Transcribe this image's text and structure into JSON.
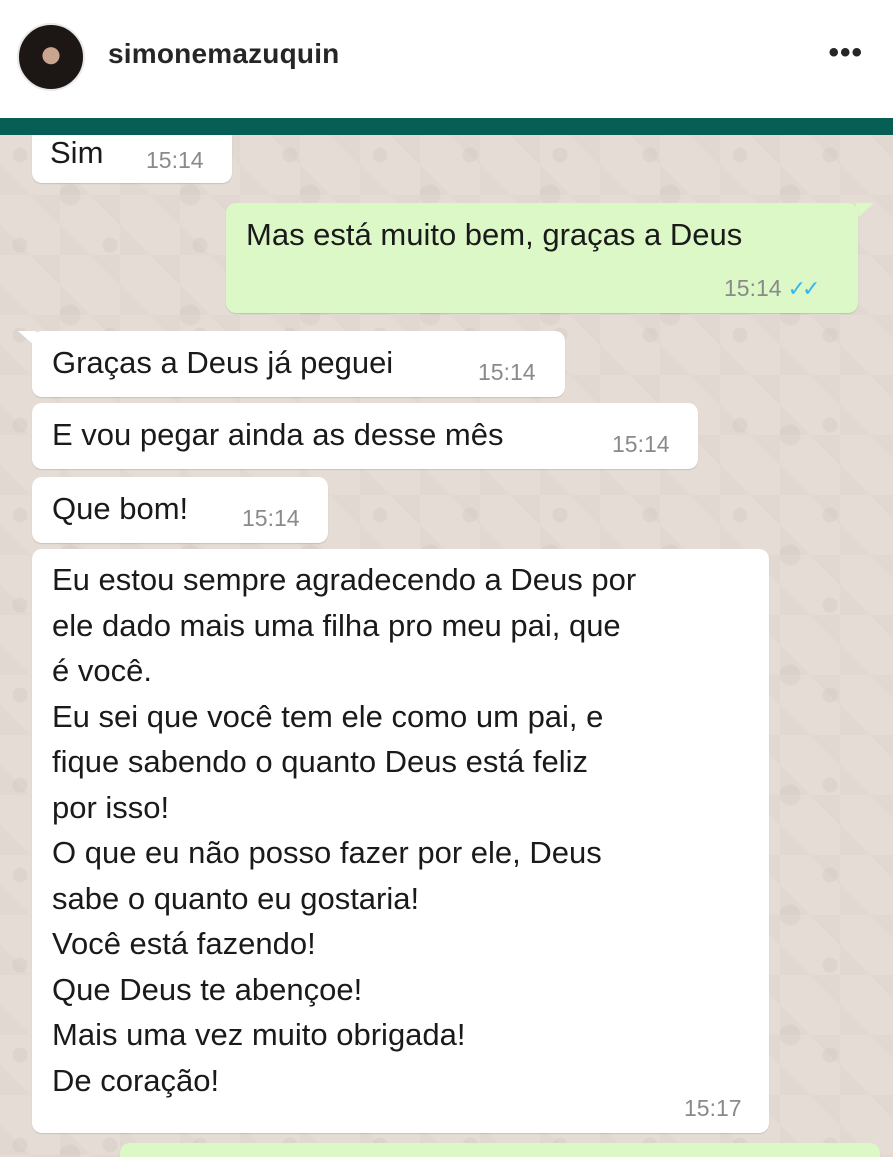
{
  "post_header": {
    "username": "simonemazuquin",
    "more_icon": "•••"
  },
  "chat": {
    "messages": [
      {
        "direction": "in",
        "text": "Sim",
        "time": "15:14"
      },
      {
        "direction": "out",
        "text": "Mas está muito bem, graças a Deus",
        "time": "15:14",
        "status_icon": "double-check-read"
      },
      {
        "direction": "in",
        "text": "Graças a Deus já peguei",
        "time": "15:14"
      },
      {
        "direction": "in",
        "text": "E vou pegar ainda as desse mês",
        "time": "15:14"
      },
      {
        "direction": "in",
        "text": "Que bom!",
        "time": "15:14"
      },
      {
        "direction": "in",
        "lines": [
          "Eu estou sempre agradecendo a Deus por",
          "ele dado mais uma filha pro meu pai, que",
          "é você.",
          "Eu sei que você tem ele como um pai,  e",
          "fique sabendo o quanto Deus está feliz",
          "por isso!",
          "O que eu não posso fazer por ele, Deus",
          "sabe o quanto eu gostaria!",
          "Você está fazendo!",
          "Que Deus te abençoe!",
          "Mais uma vez muito obrigada!",
          "De coração!"
        ],
        "time": "15:17"
      }
    ],
    "read_tick_glyph": "✓✓"
  },
  "colors": {
    "header_bar": "#075e54",
    "chat_background": "#e5ddd5",
    "incoming_bubble": "#ffffff",
    "outgoing_bubble": "#dcf8c6",
    "read_ticks": "#34b7f1"
  }
}
